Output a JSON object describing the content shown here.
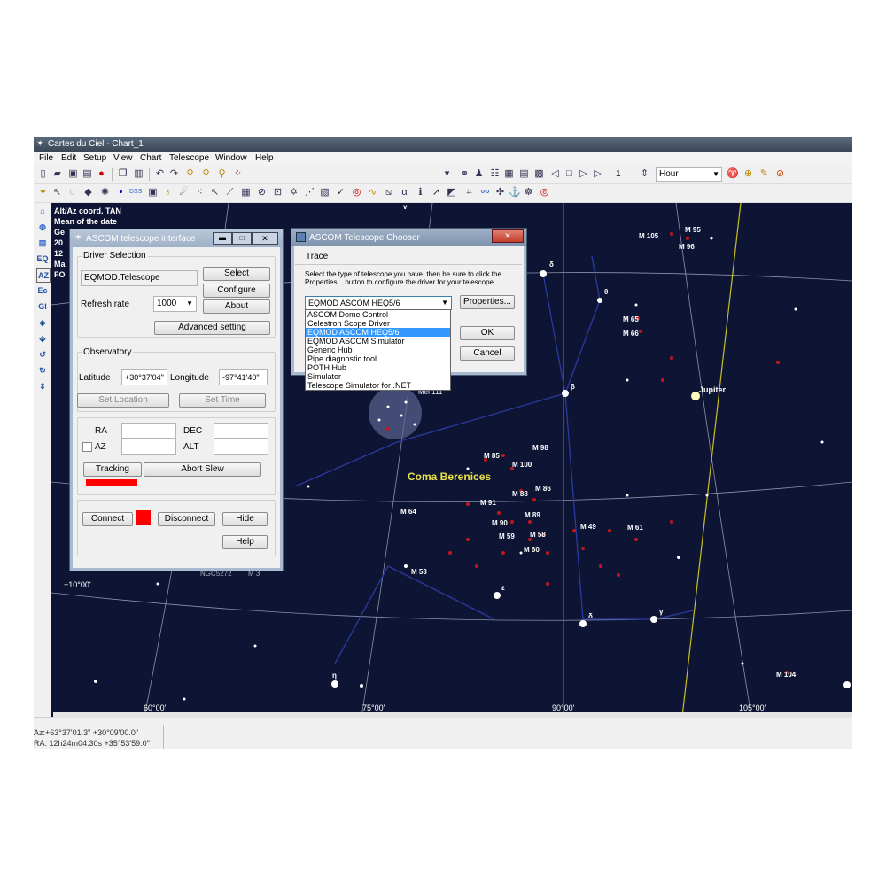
{
  "app": {
    "title": "Cartes du Ciel - Chart_1",
    "menu": [
      "File",
      "Edit",
      "Setup",
      "View",
      "Chart",
      "Telescope",
      "Window",
      "Help"
    ],
    "toolbar": {
      "step_value": "1",
      "time_unit": "Hour"
    }
  },
  "sidebar": {
    "items": [
      "EQ",
      "AZ",
      "Ec",
      "Gl"
    ]
  },
  "chart": {
    "info_lines": [
      "Alt/Az coord. TAN",
      "Mean of the date",
      "Ge",
      "20",
      "12",
      "Ma",
      "FO"
    ],
    "constellation": "Coma Berenices",
    "planet": "Jupiter",
    "grid_labels": [
      "+10°00'",
      "60°00'",
      "75°00'",
      "90°00'",
      "105°00'"
    ],
    "objects": [
      "M 105",
      "M 95",
      "M 96",
      "M 65",
      "M 66",
      "M 98",
      "M 85",
      "M 100",
      "M 88",
      "M 86",
      "M 91",
      "M 89",
      "M 90",
      "M 58",
      "M 59",
      "M 60",
      "M 49",
      "M 61",
      "M 64",
      "M 53",
      "M 104",
      "Mel 111",
      "NGC5272",
      "M 3"
    ],
    "greek": [
      "δ",
      "θ",
      "β",
      "ε",
      "δ",
      "γ",
      "η",
      "v"
    ]
  },
  "status": {
    "line1": "Az:+63°37'01.3\" +30°09'00.0\"",
    "line2": "RA: 12h24m04.30s +35°53'59.0\""
  },
  "ascom_interface": {
    "title": "ASCOM telescope interface",
    "driver_group": "Driver Selection",
    "driver": "EQMOD.Telescope",
    "select": "Select",
    "configure": "Configure",
    "refresh_label": "Refresh rate",
    "refresh_value": "1000",
    "about": "About",
    "advanced": "Advanced setting",
    "observatory_group": "Observatory",
    "latitude_label": "Latitude",
    "latitude": "+30°37'04\"",
    "longitude_label": "Longitude",
    "longitude": "-97°41'40\"",
    "set_location": "Set Location",
    "set_time": "Set Time",
    "ra_label": "RA",
    "dec_label": "DEC",
    "az_label": "AZ",
    "alt_label": "ALT",
    "tracking": "Tracking",
    "abort_slew": "Abort Slew",
    "connect": "Connect",
    "disconnect": "Disconnect",
    "hide": "Hide",
    "help": "Help",
    "status_color": "#ff0000"
  },
  "chooser": {
    "title": "ASCOM Telescope Chooser",
    "trace": "Trace",
    "instructions": "Select the type of telescope you have, then be sure to click the Properties... button to configure the driver for your telescope.",
    "selected": "EQMOD ASCOM HEQ5/6",
    "properties": "Properties...",
    "ok": "OK",
    "cancel": "Cancel",
    "options": [
      "ASCOM Dome Control",
      "Celestron Scope Driver",
      "EQMOD ASCOM HEQ5/6",
      "EQMOD ASCOM Simulator",
      "Generic Hub",
      "Pipe diagnostic tool",
      "POTH Hub",
      "Simulator",
      "Telescope Simulator for .NET"
    ]
  }
}
